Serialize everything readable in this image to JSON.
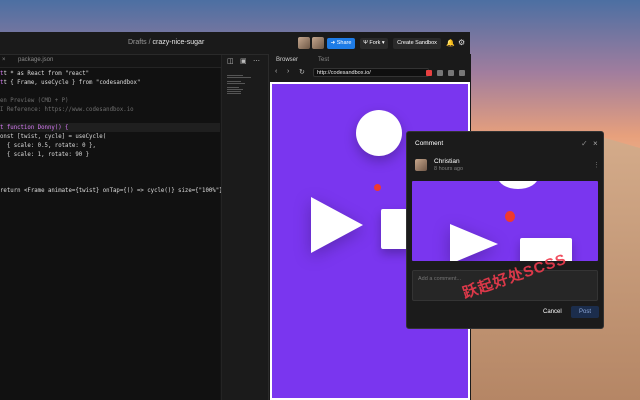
{
  "header": {
    "breadcrumb_root": "Drafts",
    "breadcrumb_sep": "/",
    "sandbox_name": "crazy-nice-sugar",
    "share_label": "Share",
    "fork_label": "Fork",
    "create_label": "Create Sandbox"
  },
  "tabs": {
    "file_tab": "package.json"
  },
  "editor": {
    "lines": [
      "t * as React from \"react\"",
      "t { Frame, useCycle } from \"codesandbox\"",
      "",
      "en Preview (CMD + P)",
      "I Reference: https://www.codesandbox.io",
      "",
      "t function Donny() {",
      "onst [twist, cycle] = useCycle(",
      "  { scale: 0.5, rotate: 0 },",
      "  { scale: 1, rotate: 90 }",
      "",
      "",
      "return <Frame animate={twist} onTap={() => cycle()} size={\"100%\"}"
    ]
  },
  "browser": {
    "tab_browser": "Browser",
    "tab_tests": "Test",
    "url": "http://codesandbox.io/"
  },
  "comment": {
    "title": "Comment",
    "user": "Christian",
    "time": "8 hours ago",
    "placeholder": "Add a comment...",
    "cancel": "Cancel",
    "post": "Post"
  },
  "watermark": "跃起好处SCSS"
}
